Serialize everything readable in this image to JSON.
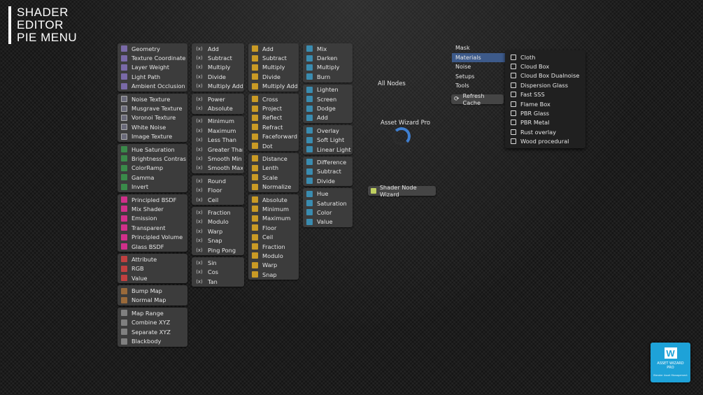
{
  "title": [
    "SHADER",
    "EDITOR",
    "PIE MENU"
  ],
  "col1": [
    [
      {
        "i": "geo",
        "t": "Geometry"
      },
      {
        "i": "geo",
        "t": "Texture Coordinate"
      },
      {
        "i": "geo",
        "t": "Layer Weight"
      },
      {
        "i": "geo",
        "t": "Light Path"
      },
      {
        "i": "geo",
        "t": "Ambient Occlusion"
      }
    ],
    [
      {
        "i": "tex",
        "t": "Noise Texture"
      },
      {
        "i": "tex",
        "t": "Musgrave Texture"
      },
      {
        "i": "tex",
        "t": "Voronoi Texture"
      },
      {
        "i": "tex",
        "t": "White Noise"
      },
      {
        "i": "tex",
        "t": "Image Texture"
      }
    ],
    [
      {
        "i": "col",
        "t": "Hue Saturation"
      },
      {
        "i": "col",
        "t": "Brightness Contrast"
      },
      {
        "i": "col",
        "t": "ColorRamp"
      },
      {
        "i": "col",
        "t": "Gamma"
      },
      {
        "i": "col",
        "t": "Invert"
      }
    ],
    [
      {
        "i": "shd",
        "t": "Principled BSDF"
      },
      {
        "i": "shd",
        "t": "Mix Shader"
      },
      {
        "i": "shd",
        "t": "Emission"
      },
      {
        "i": "shd",
        "t": "Transparent"
      },
      {
        "i": "shd",
        "t": "Principled Volume"
      },
      {
        "i": "shd",
        "t": "Glass BSDF"
      }
    ],
    [
      {
        "i": "inp",
        "t": "Attribute"
      },
      {
        "i": "inp",
        "t": "RGB"
      },
      {
        "i": "inp",
        "t": "Value"
      }
    ],
    [
      {
        "i": "vec",
        "t": "Bump Map"
      },
      {
        "i": "vec",
        "t": "Normal Map"
      }
    ],
    [
      {
        "i": "cnv",
        "t": "Map Range"
      },
      {
        "i": "cnv",
        "t": "Combine XYZ"
      },
      {
        "i": "cnv",
        "t": "Separate XYZ"
      },
      {
        "i": "cnv",
        "t": "Blackbody"
      }
    ]
  ],
  "col2": [
    [
      "Add",
      "Subtract",
      "Multiply",
      "Divide",
      "Multiply Add"
    ],
    [
      "Power",
      "Absolute"
    ],
    [
      "Minimum",
      "Maximum",
      "Less Than",
      "Greater Than",
      "Smooth Min",
      "Smooth Max"
    ],
    [
      "Round",
      "Floor",
      "Ceil"
    ],
    [
      "Fraction",
      "Modulo",
      "Warp",
      "Snap",
      "Ping Pong"
    ],
    [
      "Sin",
      "Cos",
      "Tan"
    ]
  ],
  "col3": [
    [
      "Add",
      "Subtract",
      "Multiply",
      "Divide",
      "Multiply Add"
    ],
    [
      "Cross",
      "Project",
      "Reflect",
      "Refract",
      "Faceforward",
      "Dot"
    ],
    [
      "Distance",
      "Lenth",
      "Scale",
      "Normalize"
    ],
    [
      "Absolute",
      "Minimum",
      "Maximum",
      "Floor",
      "Ceil",
      "Fraction",
      "Modulo",
      "Warp",
      "Snap"
    ]
  ],
  "col4": [
    [
      "Mix",
      "Darken",
      "Multiply",
      "Burn"
    ],
    [
      "Lighten",
      "Screen",
      "Dodge",
      "Add"
    ],
    [
      "Overlay",
      "Soft Light",
      "Linear Light"
    ],
    [
      "Difference",
      "Subtract",
      "Divide"
    ],
    [
      "Hue",
      "Saturation",
      "Color",
      "Value"
    ]
  ],
  "all_nodes": "All Nodes",
  "asset_wizard": "Asset Wizard Pro",
  "shader_node_wizard": "Shader Node Wizard",
  "categories": [
    "Mask",
    "Materials",
    "Noise",
    "Setups",
    "Tools"
  ],
  "active_category": "Materials",
  "refresh": "Refresh Cache",
  "materials": [
    "Cloth",
    "Cloud Box",
    "Cloud Box Dualnoise",
    "Dispersion Glass",
    "Fast SSS",
    "Flame Box",
    "PBR Glass",
    "PBR Metal",
    "Rust overlay",
    "Wood procedural"
  ],
  "logo": {
    "line1": "ASSET WIZARD",
    "line2": "PRO",
    "tagline": "Blender Asset Management"
  }
}
